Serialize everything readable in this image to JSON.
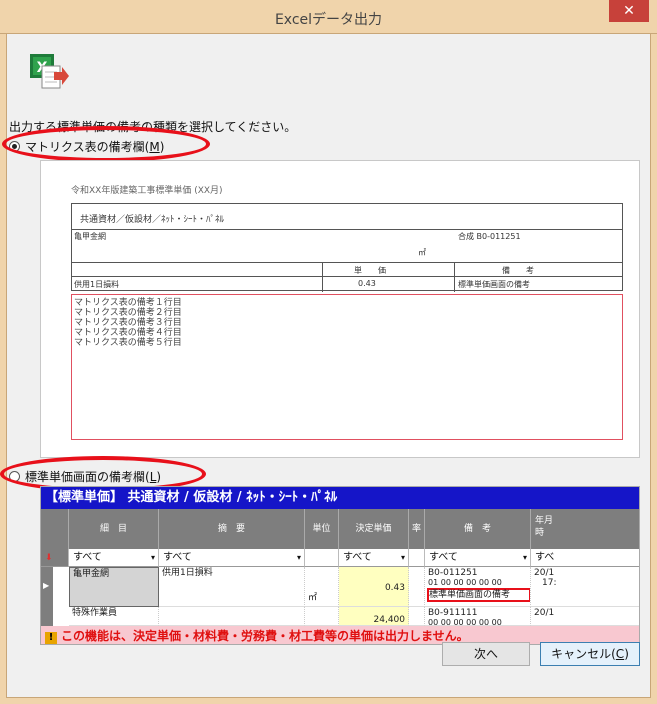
{
  "window": {
    "title": "Excelデータ出力",
    "close": "✕"
  },
  "instruction": "出力する標準単価の備考の種類を選択してください。",
  "options": [
    {
      "label": "マトリクス表の備考欄(",
      "hotkey": "M",
      "label_end": ")",
      "selected": true
    },
    {
      "label": "標準単価画面の備考欄(",
      "hotkey": "L",
      "label_end": ")",
      "selected": false
    }
  ],
  "preview1": {
    "sheet_title": "令和XX年版建築工事標準単価 (XX月)",
    "path": "共通資材／仮設材／ﾈｯﾄ・ｼｰﾄ・ﾊﾟﾈﾙ",
    "item": "亀甲金網",
    "code": "合成 B0-011251",
    "unit": "㎡",
    "col_price": "単　　価",
    "col_remark": "備　　考",
    "row_desc": "供用1日損料",
    "row_price": "0.43",
    "row_remark": "標準単価画面の備考",
    "remarks": [
      "マトリクス表の備考１行目",
      "マトリクス表の備考２行目",
      "マトリクス表の備考３行目",
      "マトリクス表の備考４行目",
      "マトリクス表の備考５行目"
    ]
  },
  "preview2": {
    "header": "【標準単価】 共通資材 / 仮設材 / ﾈｯﾄ・ｼｰﾄ・ﾊﾟﾈﾙ",
    "columns": [
      "細　目",
      "摘　要",
      "単位",
      "決定単価",
      "率",
      "備　考",
      "年月\n時"
    ],
    "filters": [
      "すべて",
      "すべて",
      "",
      "すべて",
      "",
      "すべて",
      "すべ"
    ],
    "rows": [
      {
        "name": "亀甲金網",
        "desc": "供用1日損料",
        "unit": "㎡",
        "price": "0.43",
        "remark_code": "B0-011251",
        "remark_nums": "01 00 00 00 00 00",
        "remark_text": "標準単価画面の備考",
        "date": "20/1",
        "time": "17:"
      },
      {
        "name": "特殊作業員",
        "price": "24,400",
        "remark_code": "B0-911111",
        "remark_nums": "00 00 00 00 00 00",
        "date": "20/1"
      }
    ],
    "warning": "この機能は、決定単価・材料費・労務費・材工費等の単価は出力しません。"
  },
  "buttons": {
    "next": "次へ",
    "cancel": "キャンセル(",
    "cancel_hotkey": "C",
    "cancel_end": ")"
  },
  "colors": {
    "annotation_red": "#e8101a",
    "header_blue": "#1515c8",
    "warning_bg": "#f8c8d0"
  }
}
